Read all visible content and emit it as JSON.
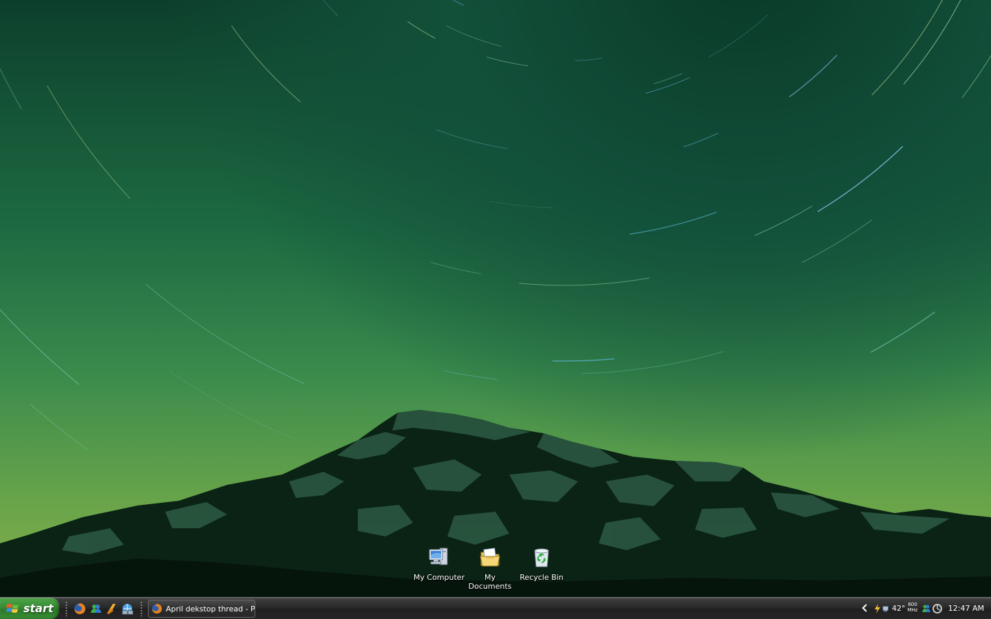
{
  "desktop": {
    "icons": [
      {
        "label": "My Computer",
        "icon": "my-computer-icon"
      },
      {
        "label": "My Documents",
        "icon": "my-documents-icon"
      },
      {
        "label": "Recycle Bin",
        "icon": "recycle-bin-icon"
      }
    ]
  },
  "taskbar": {
    "start_label": "start",
    "quick_launch": [
      "firefox-icon",
      "messenger-icon",
      "winamp-icon",
      "network-icon"
    ],
    "task_button_label": "April dekstop thread - P…",
    "task_button_icon": "firefox-icon",
    "tray": {
      "temp": "42°",
      "cpu_speed_value": "600",
      "cpu_speed_unit": "MHz",
      "clock": "12:47 AM",
      "icons": [
        "show-hidden-icons-chevron",
        "power-icon",
        "network-status-icon",
        "volume-icon",
        "messenger-tray-icon",
        "updates-icon"
      ]
    }
  },
  "colors": {
    "start_green": "#3a8e36",
    "taskbar_dark": "#262626",
    "sky_top": "#0d3f2c",
    "sky_bottom": "#84b048",
    "mountain_dark": "#08200f",
    "snow": "#2f5e45"
  }
}
